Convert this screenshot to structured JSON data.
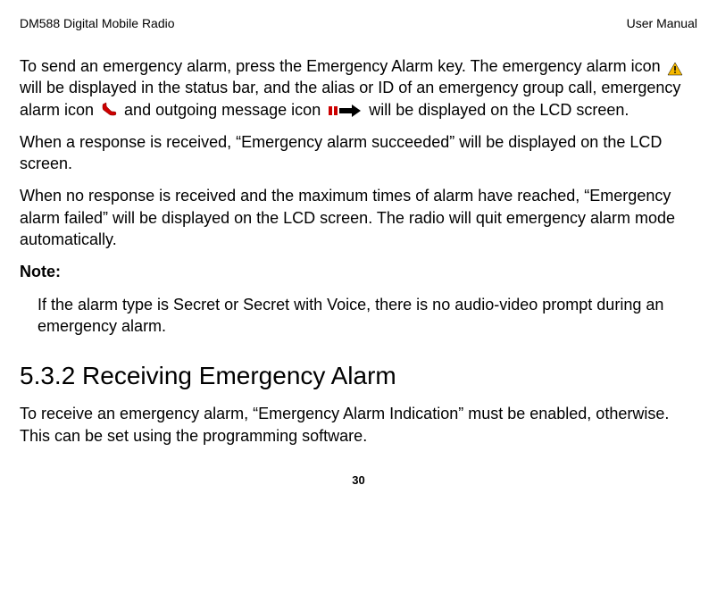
{
  "header": {
    "left": "DM588 Digital Mobile Radio",
    "right": "User Manual"
  },
  "para1": {
    "part1": "To send an emergency alarm, press the Emergency Alarm key. The emergency alarm icon ",
    "part2": " will be displayed in the status bar, and the alias or ID of an emergency group call, emergency alarm icon ",
    "part3": " and outgoing message icon ",
    "part4": " will be displayed on the LCD screen."
  },
  "para2": "When a response is received, “Emergency alarm succeeded” will be displayed on the LCD screen.",
  "para3": "When no response is received and the maximum times of alarm have reached, “Emergency alarm failed” will be displayed on the LCD screen. The radio will quit emergency alarm mode automatically.",
  "note_label": "Note:",
  "note_body": "If the alarm type is Secret or Secret with Voice, there is no audio-video prompt during an emergency alarm.",
  "section_heading": "5.3.2 Receiving Emergency Alarm",
  "para4": "To receive an emergency alarm, “Emergency Alarm Indication” must be enabled, otherwise. This can be set using the programming software.",
  "page_number": "30"
}
